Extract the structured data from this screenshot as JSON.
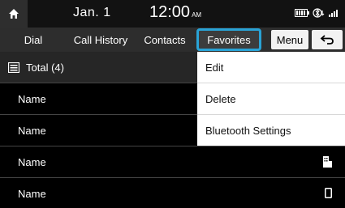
{
  "status": {
    "date": "Jan.  1",
    "time": "12:00",
    "ampm": "AM"
  },
  "tabs": {
    "dial": "Dial",
    "call_history": "Call History",
    "contacts": "Contacts",
    "favorites": "Favorites",
    "menu": "Menu"
  },
  "list": {
    "total": "Total (4)",
    "items": [
      {
        "name": "Name",
        "icon": ""
      },
      {
        "name": "Name",
        "icon": ""
      },
      {
        "name": "Name",
        "icon": "office-phone-icon"
      },
      {
        "name": "Name",
        "icon": "mobile-phone-icon"
      }
    ]
  },
  "menu_popup": {
    "items": [
      "Edit",
      "Delete",
      "Bluetooth Settings"
    ]
  },
  "colors": {
    "accent": "#29a3d6",
    "tab_bar": "#2d2d2d",
    "background": "#000000"
  }
}
